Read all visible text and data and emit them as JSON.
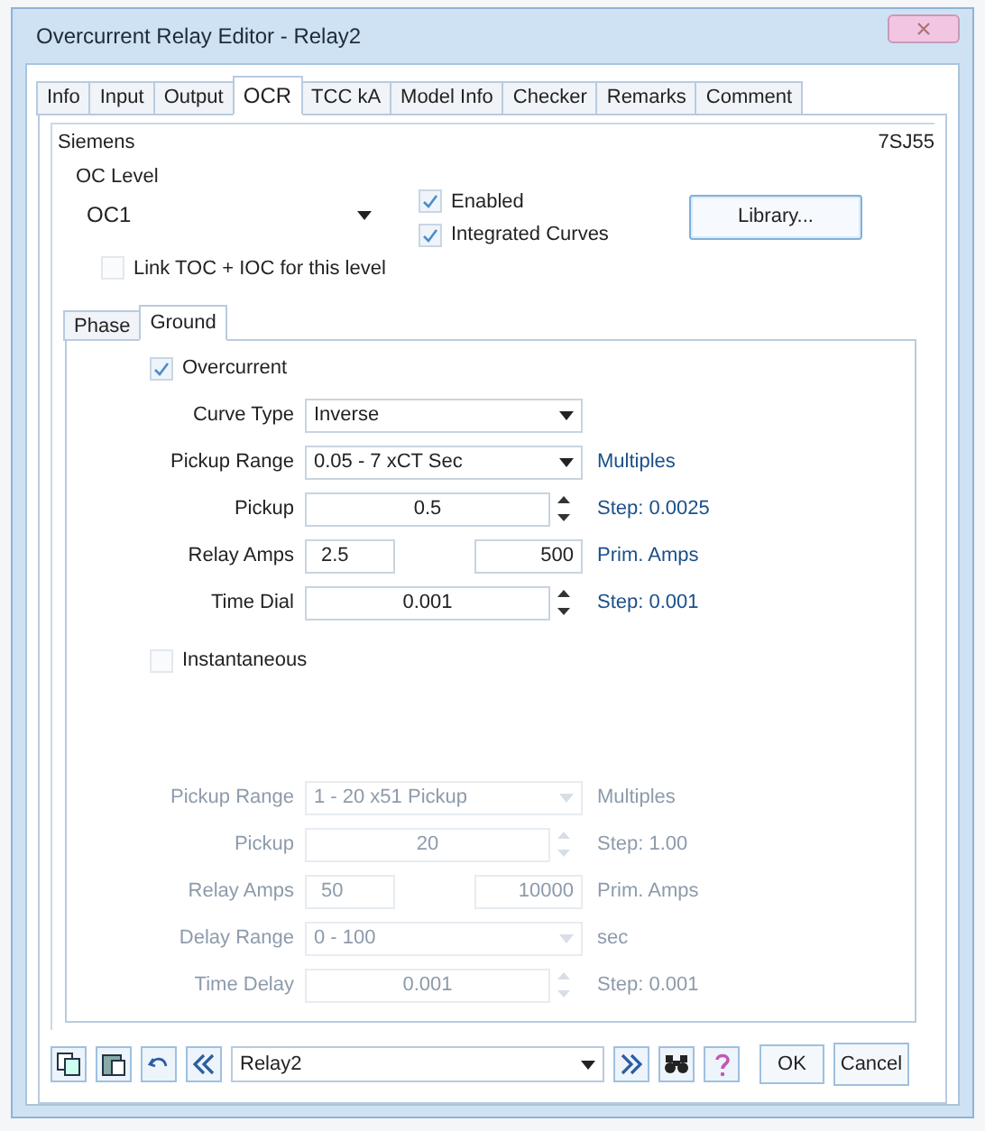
{
  "window": {
    "title": "Overcurrent Relay Editor - Relay2"
  },
  "tabs": [
    {
      "label": "Info",
      "selected": false
    },
    {
      "label": "Input",
      "selected": false
    },
    {
      "label": "Output",
      "selected": false
    },
    {
      "label": "OCR",
      "selected": true
    },
    {
      "label": "TCC kA",
      "selected": false
    },
    {
      "label": "Model Info",
      "selected": false
    },
    {
      "label": "Checker",
      "selected": false
    },
    {
      "label": "Remarks",
      "selected": false
    },
    {
      "label": "Comment",
      "selected": false
    }
  ],
  "manufacturer": "Siemens",
  "model": "7SJ55",
  "oc_level": {
    "label": "OC Level",
    "value": "OC1"
  },
  "options": [
    {
      "label": "Enabled",
      "checked": true
    },
    {
      "label": "Integrated Curves",
      "checked": true
    }
  ],
  "library_button": "Library...",
  "link_option": {
    "label": "Link TOC + IOC for this level",
    "checked": false
  },
  "sub_tabs": [
    {
      "label": "Phase",
      "selected": false
    },
    {
      "label": "Ground",
      "selected": true
    }
  ],
  "overcurrent": {
    "label": "Overcurrent",
    "checked": true,
    "rows": [
      {
        "kind": "dropdown",
        "label": "Curve Type",
        "value": "Inverse"
      },
      {
        "kind": "dropdown",
        "label": "Pickup Range",
        "value": "0.05 - 7 xCT Sec",
        "unit": "Multiples"
      },
      {
        "kind": "spin",
        "label": "Pickup",
        "value": "0.5",
        "unit": "Step: 0.0025"
      },
      {
        "kind": "pair",
        "label": "Relay Amps",
        "value": "2.5",
        "value2": "500",
        "unit": "Prim. Amps"
      },
      {
        "kind": "spin",
        "label": "Time Dial",
        "value": "0.001",
        "unit": "Step: 0.001"
      }
    ]
  },
  "instantaneous": {
    "label": "Instantaneous",
    "checked": false,
    "rows": [
      {
        "kind": "dropdown",
        "label": "Pickup Range",
        "value": "1 - 20 x51 Pickup",
        "unit": "Multiples"
      },
      {
        "kind": "spin",
        "label": "Pickup",
        "value": "20",
        "unit": "Step: 1.00"
      },
      {
        "kind": "pair",
        "label": "Relay Amps",
        "value": "50",
        "value2": "10000",
        "unit": "Prim. Amps"
      },
      {
        "kind": "dropdown",
        "label": "Delay Range",
        "value": "0 - 100",
        "unit": "sec"
      },
      {
        "kind": "spin",
        "label": "Time Delay",
        "value": "0.001",
        "unit": "Step: 0.001"
      }
    ]
  },
  "footer": {
    "relay": "Relay2",
    "ok": "OK",
    "cancel": "Cancel"
  }
}
